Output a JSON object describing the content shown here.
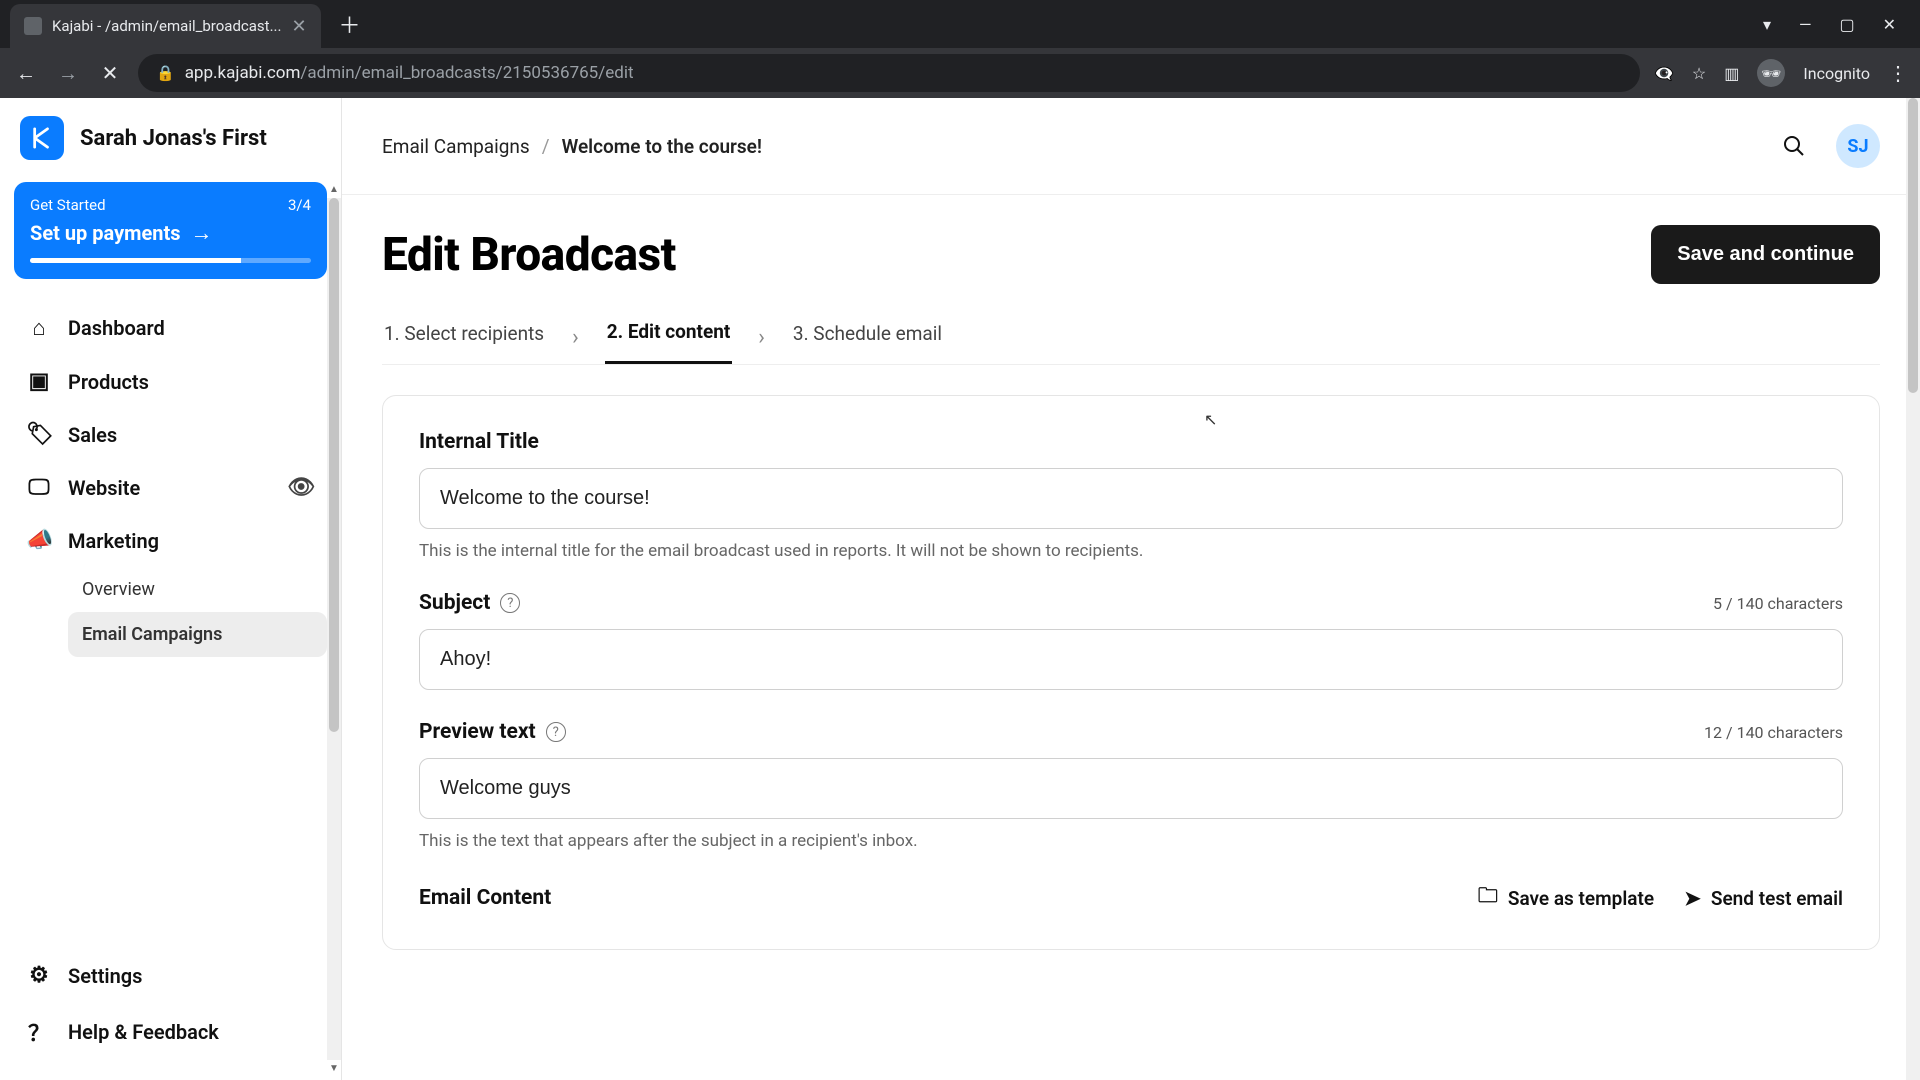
{
  "browser": {
    "tab_title": "Kajabi - /admin/email_broadcast...",
    "url_host": "app.kajabi.com",
    "url_path": "/admin/email_broadcasts/2150536765/edit",
    "incognito_label": "Incognito"
  },
  "brand": {
    "logo_letter": "K",
    "site_name": "Sarah Jonas's First"
  },
  "get_started": {
    "label": "Get Started",
    "progress_text": "3/4",
    "cta": "Set up payments"
  },
  "nav": {
    "dashboard": "Dashboard",
    "products": "Products",
    "sales": "Sales",
    "website": "Website",
    "marketing": "Marketing",
    "settings": "Settings",
    "help": "Help & Feedback",
    "marketing_sub": {
      "overview": "Overview",
      "email_campaigns": "Email Campaigns"
    }
  },
  "breadcrumb": {
    "root": "Email Campaigns",
    "current": "Welcome to the course!"
  },
  "avatar_initials": "SJ",
  "page": {
    "title": "Edit Broadcast",
    "save_btn": "Save and continue"
  },
  "steps": {
    "s1": "1. Select recipients",
    "s2": "2. Edit content",
    "s3": "3. Schedule email"
  },
  "form": {
    "internal_title": {
      "label": "Internal Title",
      "value": "Welcome to the course!",
      "helper": "This is the internal title for the email broadcast used in reports. It will not be shown to recipients."
    },
    "subject": {
      "label": "Subject",
      "value": "Ahoy!",
      "count": "5 / 140 characters"
    },
    "preview": {
      "label": "Preview text",
      "value": "Welcome guys",
      "count": "12 / 140 characters",
      "helper": "This is the text that appears after the subject in a recipient's inbox."
    },
    "email_content_label": "Email Content",
    "save_template": "Save as template",
    "send_test": "Send test email"
  }
}
